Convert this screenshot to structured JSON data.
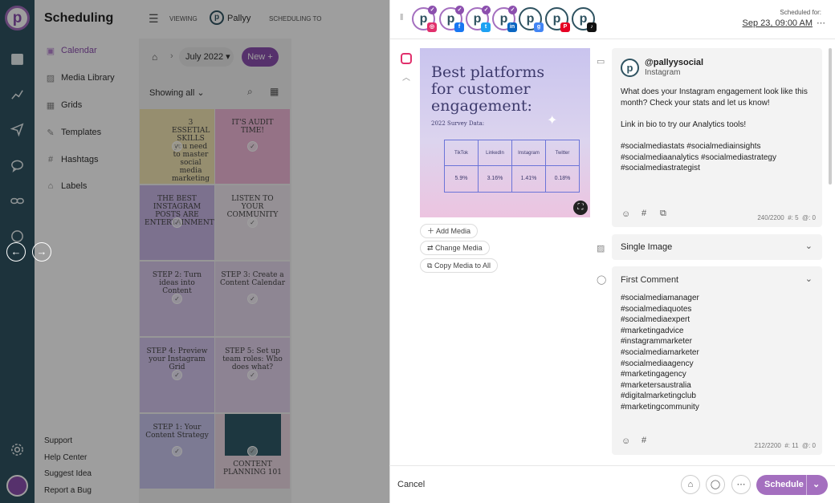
{
  "app": {
    "title": "Scheduling"
  },
  "sidebar": {
    "items": [
      {
        "label": "Calendar",
        "icon": "calendar-icon"
      },
      {
        "label": "Media Library",
        "icon": "image-icon"
      },
      {
        "label": "Grids",
        "icon": "grid-icon"
      },
      {
        "label": "Templates",
        "icon": "edit-icon"
      },
      {
        "label": "Hashtags",
        "icon": "hash-icon"
      },
      {
        "label": "Labels",
        "icon": "tag-icon"
      }
    ],
    "footer": [
      "Support",
      "Help Center",
      "Suggest Idea",
      "Report a Bug"
    ]
  },
  "header": {
    "viewing_label": "VIEWING",
    "profile": "Pallyy",
    "scheduling_to_label": "SCHEDULING TO"
  },
  "toolbar": {
    "month": "July 2022",
    "new_label": "New",
    "filter": "Showing all"
  },
  "thumbs": [
    {
      "text": "3 ESSETIAL SKILLS you need to master social media marketing"
    },
    {
      "text": "IT'S AUDIT TIME!"
    },
    {
      "text": "THE BEST INSTAGRAM POSTS ARE ENTERTAINMENT"
    },
    {
      "text": "LISTEN TO YOUR COMMUNITY"
    },
    {
      "text": "STEP 2: Turn ideas into Content"
    },
    {
      "text": "STEP 3: Create a Content Calendar"
    },
    {
      "text": "STEP 4: Preview your Instagram Grid"
    },
    {
      "text": "STEP 5: Set up team roles: Who does what?"
    },
    {
      "text": "STEP 1: Your Content Strategy"
    },
    {
      "text": "CONTENT PLANNING 101"
    }
  ],
  "composer": {
    "scheduled_label": "Scheduled for:",
    "scheduled_value": "Sep 23, 09:00 AM",
    "image": {
      "title": "Best platforms for customer engagement:",
      "subtitle": "2022 Survey Data:",
      "headers": [
        "TikTok",
        "LinkedIn",
        "Instagram",
        "Twitter"
      ],
      "values": [
        "5.9%",
        "3.16%",
        "1.41%",
        "0.18%"
      ]
    },
    "actions": [
      "Add Media",
      "Change Media",
      "Copy Media to All"
    ],
    "account": {
      "handle": "@pallyysocial",
      "network": "Instagram"
    },
    "caption": "What does your Instagram engagement look like this month? Check your stats and let us know!\n\nLink in bio to try our Analytics tools!\n\n#socialmediastats #socialmediainsights #socialmediaanalytics #socialmediastrategy #socialmediastrategist",
    "caption_count": "240/2200",
    "caption_hash": "#: 5",
    "caption_at": "@: 0",
    "post_type": "Single Image",
    "first_comment_label": "First Comment",
    "first_comment": "#socialmediamanager\n#socialmediaquotes\n#socialmediaexpert\n#marketingadvice\n#instagrammarketer\n#socialmediamarketer\n#socialmediaagency\n#marketingagency\n#marketersaustralia\n#digitalmarketingclub\n#marketingcommunity",
    "comment_count": "212/2200",
    "comment_hash": "#: 11",
    "comment_at": "@: 0",
    "cancel": "Cancel",
    "schedule": "Schedule"
  },
  "colors": {
    "accent": "#8c4fae",
    "rail": "#2f5361"
  }
}
